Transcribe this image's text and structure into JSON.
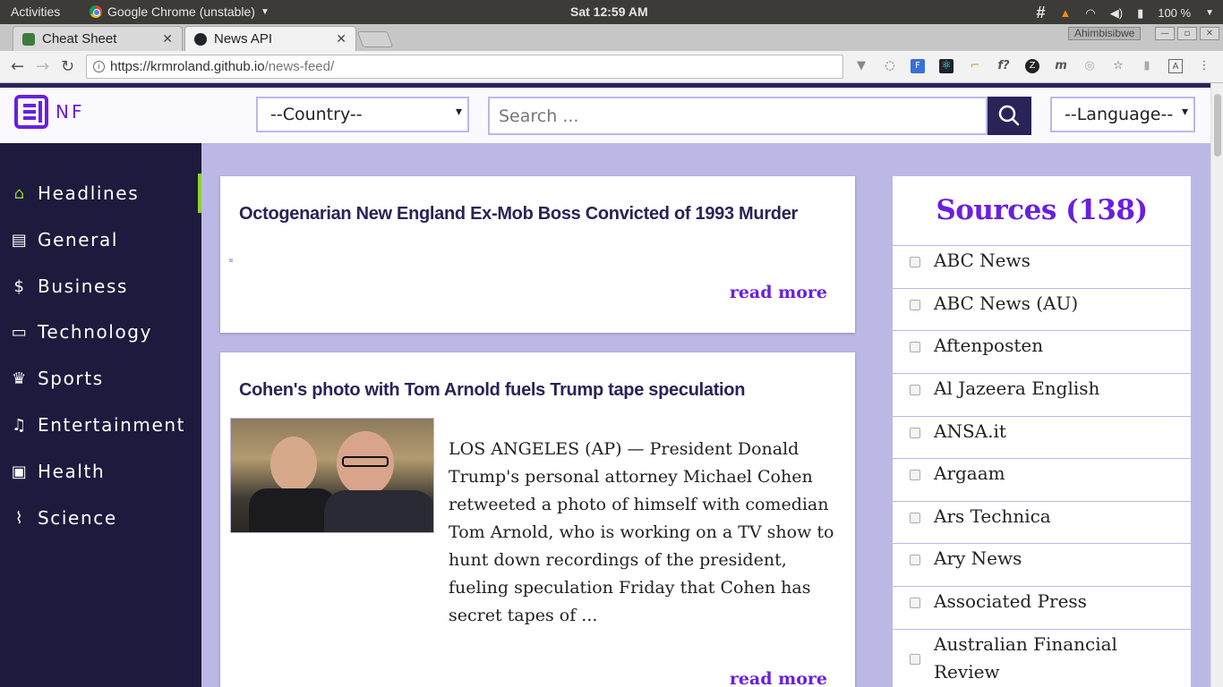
{
  "os_bar": {
    "activities": "Activities",
    "app_name": "Google Chrome (unstable)",
    "clock": "Sat 12:59 AM",
    "battery": "100 %"
  },
  "browser": {
    "tabs": [
      {
        "label": "Cheat Sheet",
        "active": false
      },
      {
        "label": "News API",
        "active": true
      }
    ],
    "user_chip": "Ahimbisibwe",
    "url_host": "https://krmroland.github.io",
    "url_path": "/news-feed/"
  },
  "header": {
    "logo_text": "NF",
    "country_select": "--Country--",
    "search_placeholder": "Search ...",
    "language_select": "--Language--"
  },
  "sidebar": {
    "items": [
      {
        "label": "Headlines",
        "icon": "home-icon",
        "active": true
      },
      {
        "label": "General",
        "icon": "document-icon",
        "active": false
      },
      {
        "label": "Business",
        "icon": "dollar-icon",
        "active": false
      },
      {
        "label": "Technology",
        "icon": "monitor-icon",
        "active": false
      },
      {
        "label": "Sports",
        "icon": "trophy-icon",
        "active": false
      },
      {
        "label": "Entertainment",
        "icon": "music-icon",
        "active": false
      },
      {
        "label": "Health",
        "icon": "id-card-icon",
        "active": false
      },
      {
        "label": "Science",
        "icon": "dna-icon",
        "active": false
      }
    ]
  },
  "articles": [
    {
      "title": "Octogenarian New England Ex-Mob Boss Convicted of 1993 Murder",
      "read_more": "read more"
    },
    {
      "title": "Cohen's photo with Tom Arnold fuels Trump tape speculation",
      "description": "LOS ANGELES (AP) — President Donald Trump's personal attorney Michael Cohen retweeted a photo of himself with comedian Tom Arnold, who is working on a TV show to hunt down recordings of the president, fueling speculation Friday that Cohen has secret tapes of ...",
      "read_more": "read more"
    }
  ],
  "sources": {
    "title": "Sources (138)",
    "items": [
      "ABC News",
      "ABC News (AU)",
      "Aftenposten",
      "Al Jazeera English",
      "ANSA.it",
      "Argaam",
      "Ars Technica",
      "Ary News",
      "Associated Press",
      "Australian Financial Review"
    ]
  },
  "colors": {
    "accent": "#6a1fe0",
    "sidebar_bg": "#1e1a3d",
    "page_bg": "#bcb8e6",
    "active_marker": "#8bd42d"
  }
}
